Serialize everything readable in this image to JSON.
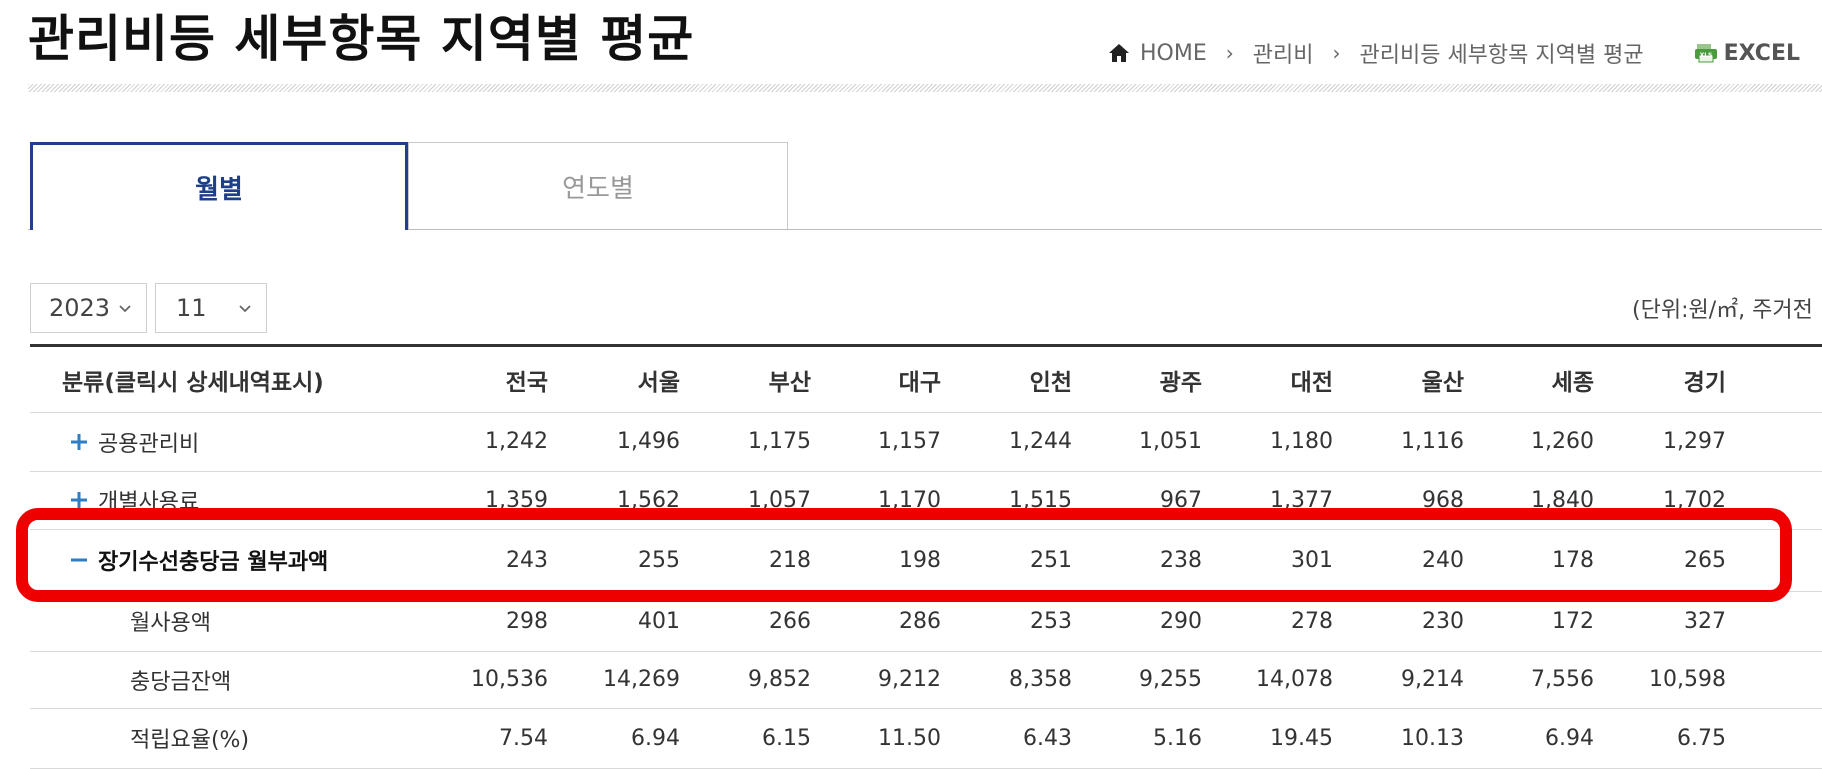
{
  "page": {
    "title": "관리비등 세부항목 지역별 평균"
  },
  "breadcrumb": {
    "home": "HOME",
    "level1": "관리비",
    "level2": "관리비등 세부항목 지역별 평균",
    "excel": "EXCEL"
  },
  "tabs": [
    {
      "label": "월별",
      "active": true
    },
    {
      "label": "연도별",
      "active": false
    }
  ],
  "filters": {
    "year": "2023",
    "month": "11"
  },
  "unit_note": "(단위:원/㎡, 주거전",
  "table": {
    "category_header": "분류(클릭시 상세내역표시)",
    "columns": [
      "전국",
      "서울",
      "부산",
      "대구",
      "인천",
      "광주",
      "대전",
      "울산",
      "세종",
      "경기"
    ],
    "rows": [
      {
        "label": "공용관리비",
        "icon": "plus-icon",
        "values": [
          "1,242",
          "1,496",
          "1,175",
          "1,157",
          "1,244",
          "1,051",
          "1,180",
          "1,116",
          "1,260",
          "1,297"
        ]
      },
      {
        "label": "개별사용료",
        "icon": "plus-icon",
        "values": [
          "1,359",
          "1,562",
          "1,057",
          "1,170",
          "1,515",
          "967",
          "1,377",
          "968",
          "1,840",
          "1,702"
        ]
      },
      {
        "label": "장기수선충당금 월부과액",
        "icon": "minus-icon",
        "values": [
          "243",
          "255",
          "218",
          "198",
          "251",
          "238",
          "301",
          "240",
          "178",
          "265"
        ]
      },
      {
        "label": "월사용액",
        "icon": "",
        "values": [
          "298",
          "401",
          "266",
          "286",
          "253",
          "290",
          "278",
          "230",
          "172",
          "327"
        ]
      },
      {
        "label": "충당금잔액",
        "icon": "",
        "values": [
          "10,536",
          "14,269",
          "9,852",
          "9,212",
          "8,358",
          "9,255",
          "14,078",
          "9,214",
          "7,556",
          "10,598"
        ]
      },
      {
        "label": "적립요율(%)",
        "icon": "",
        "values": [
          "7.54",
          "6.94",
          "6.15",
          "11.50",
          "6.43",
          "5.16",
          "19.45",
          "10.13",
          "6.94",
          "6.75"
        ]
      }
    ]
  },
  "colors": {
    "accent": "#1f3f88",
    "icon_blue": "#2f7ec5",
    "highlight": "#ee0000"
  }
}
